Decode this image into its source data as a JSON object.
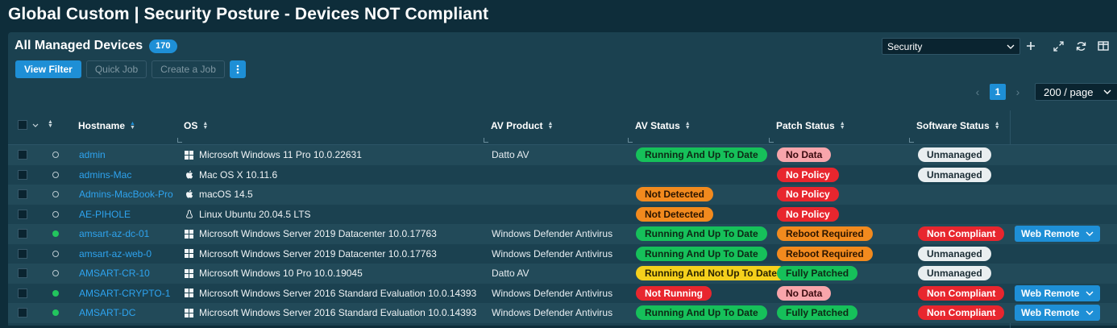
{
  "page_title": "Global Custom | Security Posture - Devices NOT Compliant",
  "panel": {
    "title": "All Managed Devices",
    "count": "170",
    "toolbar": {
      "view_filter": "View Filter",
      "quick_job": "Quick Job",
      "create_job": "Create a Job",
      "more_icon": "kebab-icon"
    },
    "view_select": "Security",
    "pagination": {
      "current_page": "1",
      "per_page": "200 / page"
    }
  },
  "columns": {
    "hostname": "Hostname",
    "os": "OS",
    "av_product": "AV Product",
    "av_status": "AV Status",
    "patch_status": "Patch Status",
    "software_status": "Software Status"
  },
  "rows": [
    {
      "online": false,
      "hostname": "admin",
      "os_icon": "windows-icon",
      "os": "Microsoft Windows 11 Pro 10.0.22631",
      "av_product": "Datto AV",
      "av_status": "Running And Up To Date",
      "av_color": "green",
      "patch_status": "No Data",
      "patch_color": "pink",
      "software_status": "Unmanaged",
      "software_color": "gray",
      "web_remote": ""
    },
    {
      "online": false,
      "hostname": "admins-Mac",
      "os_icon": "apple-icon",
      "os": "Mac OS X 10.11.6",
      "av_product": "",
      "av_status": "",
      "av_color": "",
      "patch_status": "No Policy",
      "patch_color": "red",
      "software_status": "Unmanaged",
      "software_color": "gray",
      "web_remote": ""
    },
    {
      "online": false,
      "hostname": "Admins-MacBook-Pro",
      "os_icon": "apple-icon",
      "os": "macOS 14.5",
      "av_product": "",
      "av_status": "Not Detected",
      "av_color": "orange",
      "patch_status": "No Policy",
      "patch_color": "red",
      "software_status": "",
      "software_color": "",
      "web_remote": ""
    },
    {
      "online": false,
      "hostname": "AE-PIHOLE",
      "os_icon": "linux-icon",
      "os": "Linux Ubuntu 20.04.5 LTS",
      "av_product": "",
      "av_status": "Not Detected",
      "av_color": "orange",
      "patch_status": "No Policy",
      "patch_color": "red",
      "software_status": "",
      "software_color": "",
      "web_remote": ""
    },
    {
      "online": true,
      "hostname": "amsart-az-dc-01",
      "os_icon": "windows-icon",
      "os": "Microsoft Windows Server 2019 Datacenter 10.0.17763",
      "av_product": "Windows Defender Antivirus",
      "av_status": "Running And Up To Date",
      "av_color": "green",
      "patch_status": "Reboot Required",
      "patch_color": "orange",
      "software_status": "Non Compliant",
      "software_color": "red",
      "web_remote": "Web Remote"
    },
    {
      "online": false,
      "hostname": "amsart-az-web-0",
      "os_icon": "windows-icon",
      "os": "Microsoft Windows Server 2019 Datacenter 10.0.17763",
      "av_product": "Windows Defender Antivirus",
      "av_status": "Running And Up To Date",
      "av_color": "green",
      "patch_status": "Reboot Required",
      "patch_color": "orange",
      "software_status": "Unmanaged",
      "software_color": "gray",
      "web_remote": ""
    },
    {
      "online": false,
      "hostname": "AMSART-CR-10",
      "os_icon": "windows-icon",
      "os": "Microsoft Windows 10 Pro 10.0.19045",
      "av_product": "Datto AV",
      "av_status": "Running And Not Up To Date",
      "av_color": "yellow",
      "patch_status": "Fully Patched",
      "patch_color": "green",
      "software_status": "Unmanaged",
      "software_color": "gray",
      "web_remote": ""
    },
    {
      "online": true,
      "hostname": "AMSART-CRYPTO-1",
      "os_icon": "windows-icon",
      "os": "Microsoft Windows Server 2016 Standard Evaluation 10.0.14393",
      "av_product": "Windows Defender Antivirus",
      "av_status": "Not Running",
      "av_color": "red",
      "patch_status": "No Data",
      "patch_color": "pink",
      "software_status": "Non Compliant",
      "software_color": "red",
      "web_remote": "Web Remote"
    },
    {
      "online": true,
      "hostname": "AMSART-DC",
      "os_icon": "windows-icon",
      "os": "Microsoft Windows Server 2016 Standard Evaluation 10.0.14393",
      "av_product": "Windows Defender Antivirus",
      "av_status": "Running And Up To Date",
      "av_color": "green",
      "patch_status": "Fully Patched",
      "patch_color": "green",
      "software_status": "Non Compliant",
      "software_color": "red",
      "web_remote": "Web Remote"
    }
  ]
}
